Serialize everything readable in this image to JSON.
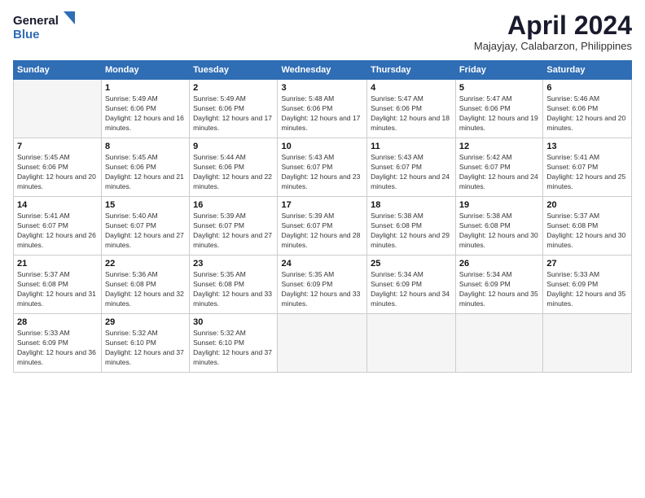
{
  "logo": {
    "line1": "General",
    "line2": "Blue"
  },
  "title": "April 2024",
  "subtitle": "Majayjay, Calabarzon, Philippines",
  "days_of_week": [
    "Sunday",
    "Monday",
    "Tuesday",
    "Wednesday",
    "Thursday",
    "Friday",
    "Saturday"
  ],
  "weeks": [
    [
      {
        "day": "",
        "empty": true
      },
      {
        "day": "1",
        "sunrise": "5:49 AM",
        "sunset": "6:06 PM",
        "daylight": "12 hours and 16 minutes."
      },
      {
        "day": "2",
        "sunrise": "5:49 AM",
        "sunset": "6:06 PM",
        "daylight": "12 hours and 17 minutes."
      },
      {
        "day": "3",
        "sunrise": "5:48 AM",
        "sunset": "6:06 PM",
        "daylight": "12 hours and 17 minutes."
      },
      {
        "day": "4",
        "sunrise": "5:47 AM",
        "sunset": "6:06 PM",
        "daylight": "12 hours and 18 minutes."
      },
      {
        "day": "5",
        "sunrise": "5:47 AM",
        "sunset": "6:06 PM",
        "daylight": "12 hours and 19 minutes."
      },
      {
        "day": "6",
        "sunrise": "5:46 AM",
        "sunset": "6:06 PM",
        "daylight": "12 hours and 20 minutes."
      }
    ],
    [
      {
        "day": "7",
        "sunrise": "5:45 AM",
        "sunset": "6:06 PM",
        "daylight": "12 hours and 20 minutes."
      },
      {
        "day": "8",
        "sunrise": "5:45 AM",
        "sunset": "6:06 PM",
        "daylight": "12 hours and 21 minutes."
      },
      {
        "day": "9",
        "sunrise": "5:44 AM",
        "sunset": "6:06 PM",
        "daylight": "12 hours and 22 minutes."
      },
      {
        "day": "10",
        "sunrise": "5:43 AM",
        "sunset": "6:07 PM",
        "daylight": "12 hours and 23 minutes."
      },
      {
        "day": "11",
        "sunrise": "5:43 AM",
        "sunset": "6:07 PM",
        "daylight": "12 hours and 24 minutes."
      },
      {
        "day": "12",
        "sunrise": "5:42 AM",
        "sunset": "6:07 PM",
        "daylight": "12 hours and 24 minutes."
      },
      {
        "day": "13",
        "sunrise": "5:41 AM",
        "sunset": "6:07 PM",
        "daylight": "12 hours and 25 minutes."
      }
    ],
    [
      {
        "day": "14",
        "sunrise": "5:41 AM",
        "sunset": "6:07 PM",
        "daylight": "12 hours and 26 minutes."
      },
      {
        "day": "15",
        "sunrise": "5:40 AM",
        "sunset": "6:07 PM",
        "daylight": "12 hours and 27 minutes."
      },
      {
        "day": "16",
        "sunrise": "5:39 AM",
        "sunset": "6:07 PM",
        "daylight": "12 hours and 27 minutes."
      },
      {
        "day": "17",
        "sunrise": "5:39 AM",
        "sunset": "6:07 PM",
        "daylight": "12 hours and 28 minutes."
      },
      {
        "day": "18",
        "sunrise": "5:38 AM",
        "sunset": "6:08 PM",
        "daylight": "12 hours and 29 minutes."
      },
      {
        "day": "19",
        "sunrise": "5:38 AM",
        "sunset": "6:08 PM",
        "daylight": "12 hours and 30 minutes."
      },
      {
        "day": "20",
        "sunrise": "5:37 AM",
        "sunset": "6:08 PM",
        "daylight": "12 hours and 30 minutes."
      }
    ],
    [
      {
        "day": "21",
        "sunrise": "5:37 AM",
        "sunset": "6:08 PM",
        "daylight": "12 hours and 31 minutes."
      },
      {
        "day": "22",
        "sunrise": "5:36 AM",
        "sunset": "6:08 PM",
        "daylight": "12 hours and 32 minutes."
      },
      {
        "day": "23",
        "sunrise": "5:35 AM",
        "sunset": "6:08 PM",
        "daylight": "12 hours and 33 minutes."
      },
      {
        "day": "24",
        "sunrise": "5:35 AM",
        "sunset": "6:09 PM",
        "daylight": "12 hours and 33 minutes."
      },
      {
        "day": "25",
        "sunrise": "5:34 AM",
        "sunset": "6:09 PM",
        "daylight": "12 hours and 34 minutes."
      },
      {
        "day": "26",
        "sunrise": "5:34 AM",
        "sunset": "6:09 PM",
        "daylight": "12 hours and 35 minutes."
      },
      {
        "day": "27",
        "sunrise": "5:33 AM",
        "sunset": "6:09 PM",
        "daylight": "12 hours and 35 minutes."
      }
    ],
    [
      {
        "day": "28",
        "sunrise": "5:33 AM",
        "sunset": "6:09 PM",
        "daylight": "12 hours and 36 minutes."
      },
      {
        "day": "29",
        "sunrise": "5:32 AM",
        "sunset": "6:10 PM",
        "daylight": "12 hours and 37 minutes."
      },
      {
        "day": "30",
        "sunrise": "5:32 AM",
        "sunset": "6:10 PM",
        "daylight": "12 hours and 37 minutes."
      },
      {
        "day": "",
        "empty": true
      },
      {
        "day": "",
        "empty": true
      },
      {
        "day": "",
        "empty": true
      },
      {
        "day": "",
        "empty": true
      }
    ]
  ],
  "labels": {
    "sunrise": "Sunrise:",
    "sunset": "Sunset:",
    "daylight": "Daylight:"
  }
}
